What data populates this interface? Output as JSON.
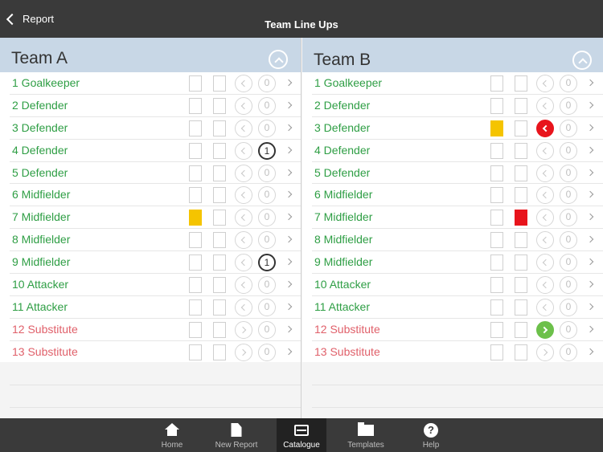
{
  "nav": {
    "back_label": "Report",
    "title": "Team Line Ups"
  },
  "teams": [
    {
      "name": "Team A",
      "players": [
        {
          "label": "1 Goalkeeper",
          "type": "player",
          "yellow": false,
          "red": false,
          "arrow": "left",
          "arrow_state": "none",
          "count": "0",
          "count_active": false
        },
        {
          "label": "2 Defender",
          "type": "player",
          "yellow": false,
          "red": false,
          "arrow": "left",
          "arrow_state": "none",
          "count": "0",
          "count_active": false
        },
        {
          "label": "3 Defender",
          "type": "player",
          "yellow": false,
          "red": false,
          "arrow": "left",
          "arrow_state": "none",
          "count": "0",
          "count_active": false
        },
        {
          "label": "4 Defender",
          "type": "player",
          "yellow": false,
          "red": false,
          "arrow": "left",
          "arrow_state": "none",
          "count": "1",
          "count_active": true
        },
        {
          "label": "5 Defender",
          "type": "player",
          "yellow": false,
          "red": false,
          "arrow": "left",
          "arrow_state": "none",
          "count": "0",
          "count_active": false
        },
        {
          "label": "6 Midfielder",
          "type": "player",
          "yellow": false,
          "red": false,
          "arrow": "left",
          "arrow_state": "none",
          "count": "0",
          "count_active": false
        },
        {
          "label": "7 Midfielder",
          "type": "player",
          "yellow": true,
          "red": false,
          "arrow": "left",
          "arrow_state": "none",
          "count": "0",
          "count_active": false
        },
        {
          "label": "8 Midfielder",
          "type": "player",
          "yellow": false,
          "red": false,
          "arrow": "left",
          "arrow_state": "none",
          "count": "0",
          "count_active": false
        },
        {
          "label": "9 Midfielder",
          "type": "player",
          "yellow": false,
          "red": false,
          "arrow": "left",
          "arrow_state": "none",
          "count": "1",
          "count_active": true
        },
        {
          "label": "10 Attacker",
          "type": "player",
          "yellow": false,
          "red": false,
          "arrow": "left",
          "arrow_state": "none",
          "count": "0",
          "count_active": false
        },
        {
          "label": "11 Attacker",
          "type": "player",
          "yellow": false,
          "red": false,
          "arrow": "left",
          "arrow_state": "none",
          "count": "0",
          "count_active": false
        },
        {
          "label": "12 Substitute",
          "type": "sub",
          "yellow": false,
          "red": false,
          "arrow": "right",
          "arrow_state": "none",
          "count": "0",
          "count_active": false
        },
        {
          "label": "13 Substitute",
          "type": "sub",
          "yellow": false,
          "red": false,
          "arrow": "right",
          "arrow_state": "none",
          "count": "0",
          "count_active": false
        }
      ]
    },
    {
      "name": "Team B",
      "players": [
        {
          "label": "1 Goalkeeper",
          "type": "player",
          "yellow": false,
          "red": false,
          "arrow": "left",
          "arrow_state": "none",
          "count": "0",
          "count_active": false
        },
        {
          "label": "2 Defender",
          "type": "player",
          "yellow": false,
          "red": false,
          "arrow": "left",
          "arrow_state": "none",
          "count": "0",
          "count_active": false
        },
        {
          "label": "3 Defender",
          "type": "player",
          "yellow": true,
          "red": false,
          "arrow": "left",
          "arrow_state": "red",
          "count": "0",
          "count_active": false
        },
        {
          "label": "4 Defender",
          "type": "player",
          "yellow": false,
          "red": false,
          "arrow": "left",
          "arrow_state": "none",
          "count": "0",
          "count_active": false
        },
        {
          "label": "5 Defender",
          "type": "player",
          "yellow": false,
          "red": false,
          "arrow": "left",
          "arrow_state": "none",
          "count": "0",
          "count_active": false
        },
        {
          "label": "6 Midfielder",
          "type": "player",
          "yellow": false,
          "red": false,
          "arrow": "left",
          "arrow_state": "none",
          "count": "0",
          "count_active": false
        },
        {
          "label": "7 Midfielder",
          "type": "player",
          "yellow": false,
          "red": true,
          "arrow": "left",
          "arrow_state": "none",
          "count": "0",
          "count_active": false
        },
        {
          "label": "8 Midfielder",
          "type": "player",
          "yellow": false,
          "red": false,
          "arrow": "left",
          "arrow_state": "none",
          "count": "0",
          "count_active": false
        },
        {
          "label": "9 Midfielder",
          "type": "player",
          "yellow": false,
          "red": false,
          "arrow": "left",
          "arrow_state": "none",
          "count": "0",
          "count_active": false
        },
        {
          "label": "10 Attacker",
          "type": "player",
          "yellow": false,
          "red": false,
          "arrow": "left",
          "arrow_state": "none",
          "count": "0",
          "count_active": false
        },
        {
          "label": "11 Attacker",
          "type": "player",
          "yellow": false,
          "red": false,
          "arrow": "left",
          "arrow_state": "none",
          "count": "0",
          "count_active": false
        },
        {
          "label": "12 Substitute",
          "type": "sub",
          "yellow": false,
          "red": false,
          "arrow": "right",
          "arrow_state": "green",
          "count": "0",
          "count_active": false
        },
        {
          "label": "13 Substitute",
          "type": "sub",
          "yellow": false,
          "red": false,
          "arrow": "right",
          "arrow_state": "none",
          "count": "0",
          "count_active": false
        }
      ]
    }
  ],
  "tabs": [
    {
      "label": "Home",
      "icon": "home-icon",
      "active": false
    },
    {
      "label": "New Report",
      "icon": "document-icon",
      "active": false
    },
    {
      "label": "Catalogue",
      "icon": "catalogue-box-icon",
      "active": true
    },
    {
      "label": "Templates",
      "icon": "folder-icon",
      "active": false
    },
    {
      "label": "Help",
      "icon": "help-icon",
      "active": false
    }
  ],
  "colors": {
    "navbar": "#3a3a3a",
    "panel_header": "#c8d7e6",
    "player_text": "#2e9e44",
    "substitute_text": "#e0606a",
    "yellow_card": "#f5c400",
    "red_card": "#e8141c",
    "sub_in": "#6cc04a"
  }
}
